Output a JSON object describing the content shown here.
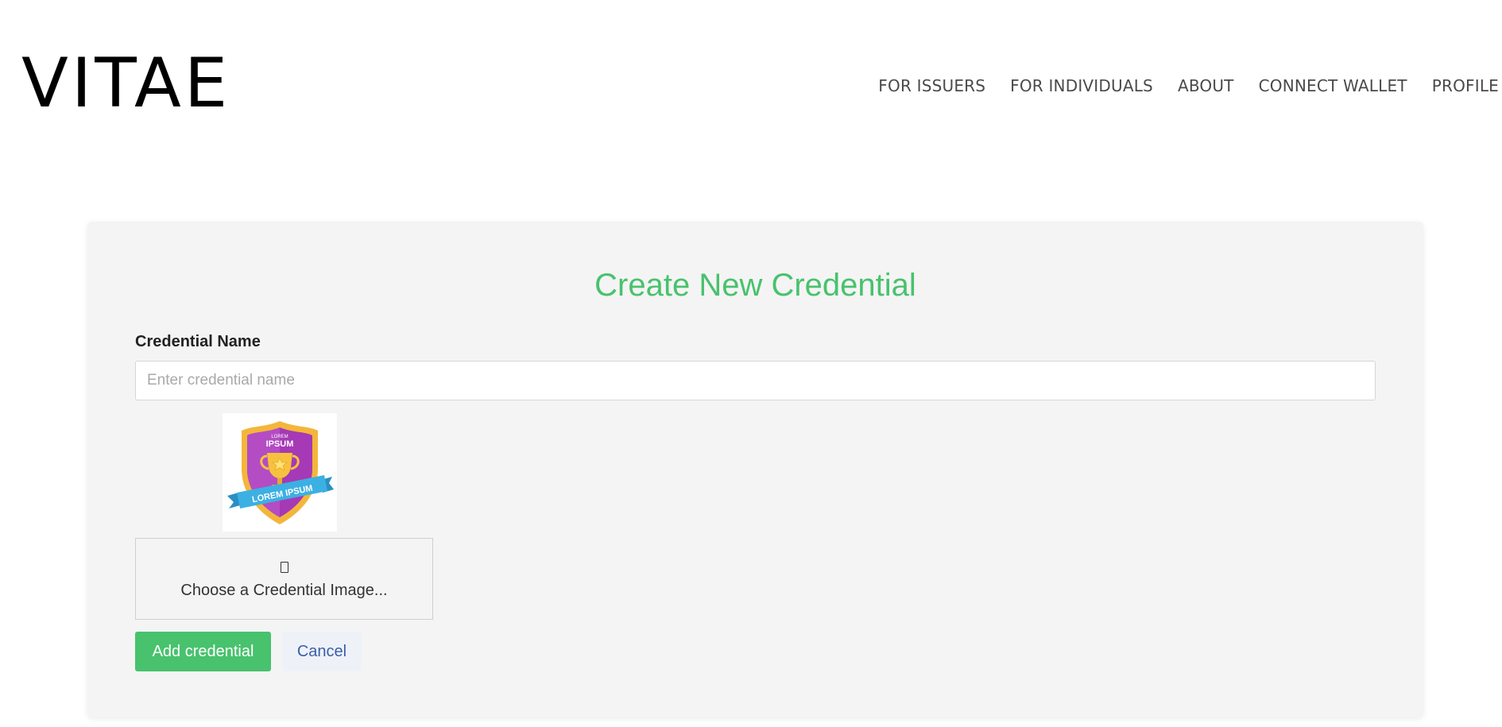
{
  "header": {
    "logo_text": "VITAE",
    "nav": [
      {
        "label": "FOR ISSUERS"
      },
      {
        "label": "FOR INDIVIDUALS"
      },
      {
        "label": "ABOUT"
      },
      {
        "label": "CONNECT WALLET"
      },
      {
        "label": "PROFILE"
      }
    ]
  },
  "form": {
    "title": "Create New Credential",
    "name_label": "Credential Name",
    "name_placeholder": "Enter credential name",
    "name_value": "",
    "badge": {
      "top_small": "LOREM",
      "top_big": "IPSUM",
      "ribbon": "LOREM IPSUM"
    },
    "file_icon": "file-icon",
    "file_label": "Choose a Credential Image...",
    "add_button": "Add credential",
    "cancel_button": "Cancel"
  },
  "colors": {
    "accent": "#48c26d",
    "cancel_text": "#3a5fa8",
    "card_bg": "#f4f4f4"
  }
}
